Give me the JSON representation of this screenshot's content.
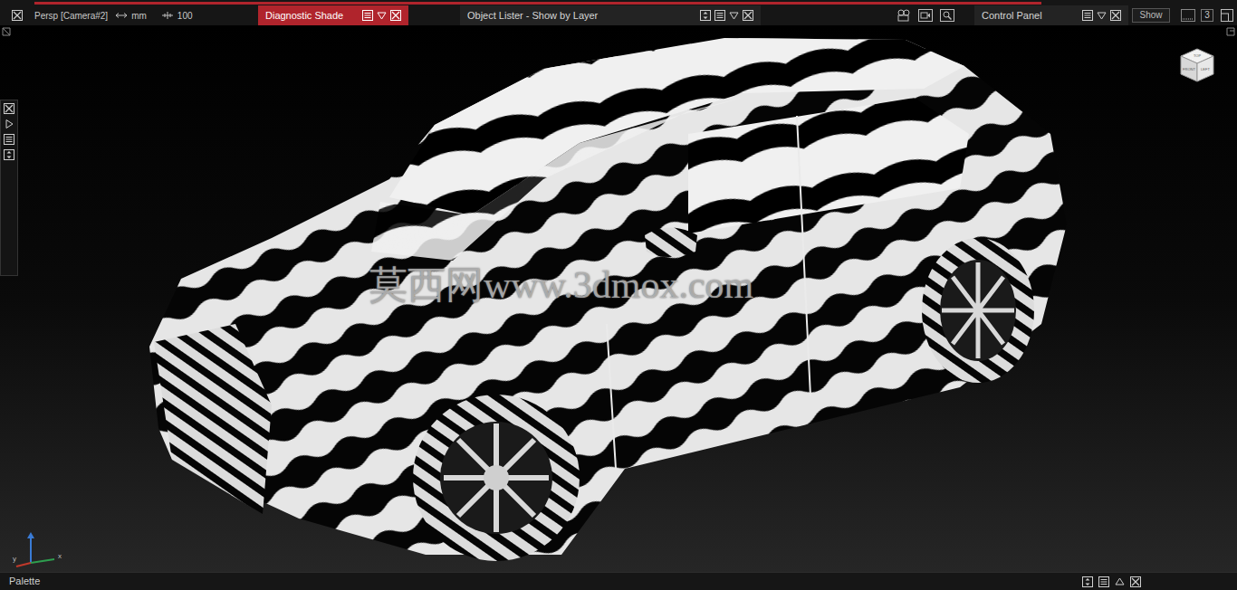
{
  "viewport_header": {
    "camera": "Persp [Camera#2]",
    "units": "mm",
    "scale": "100"
  },
  "panels": [
    {
      "label": "Diagnostic Shade",
      "selected": true
    },
    {
      "label": "Object Lister - Show by Layer",
      "selected": false
    },
    {
      "label": "Control Panel",
      "selected": false
    }
  ],
  "control_panel": {
    "show_button": "Show",
    "layout_number": "3"
  },
  "view_cube": {
    "faces": [
      "TOP",
      "FRONT",
      "LEFT"
    ]
  },
  "axes": {
    "x": "x",
    "y": "y"
  },
  "watermark": "莫西网www.3dmox.com",
  "bottom_bar": {
    "title": "Palette"
  }
}
